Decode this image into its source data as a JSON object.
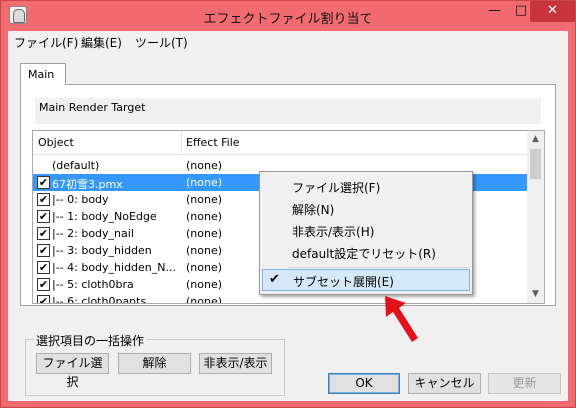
{
  "window": {
    "title": "エフェクトファイル割り当て",
    "minimize": "—",
    "maximize": "□",
    "close": "✕"
  },
  "menu": [
    "ファイル(F)",
    "編集(E)",
    "ツール(T)"
  ],
  "tab": {
    "label": "Main"
  },
  "render_target": {
    "label": "Main Render Target"
  },
  "list": {
    "columns": {
      "object": "Object",
      "effect": "Effect File"
    },
    "rows": [
      {
        "object": "(default)",
        "effect": "(none)",
        "checked": false
      },
      {
        "object": "67初雪3.pmx",
        "effect": "(none)",
        "checked": true,
        "selected": true
      },
      {
        "object": "|-- 0: body",
        "effect": "(none)",
        "checked": true
      },
      {
        "object": "|-- 1: body_NoEdge",
        "effect": "(none)",
        "checked": true
      },
      {
        "object": "|-- 2: body_nail",
        "effect": "(none)",
        "checked": true
      },
      {
        "object": "|-- 3: body_hidden",
        "effect": "(none)",
        "checked": true
      },
      {
        "object": "|-- 4: body_hidden_N...",
        "effect": "(none)",
        "checked": true
      },
      {
        "object": "|-- 5: cloth0bra",
        "effect": "(none)",
        "checked": true
      },
      {
        "object": "|-- 6: cloth0pants",
        "effect": "(none)",
        "checked": true
      }
    ],
    "scroll_up": "▲",
    "scroll_down": "▼"
  },
  "context_menu": {
    "items": [
      "ファイル選択(F)",
      "解除(N)",
      "非表示/表示(H)",
      "default設定でリセット(R)"
    ],
    "checked_item": "サブセット展開(E)",
    "check_mark": "✔"
  },
  "bulk": {
    "title": "選択項目の一括操作",
    "buttons": [
      "ファイル選択",
      "解除",
      "非表示/表示"
    ]
  },
  "dialog_buttons": {
    "ok": "OK",
    "cancel": "キャンセル",
    "update": "更新"
  },
  "colors": {
    "title_bar": "#f26b70",
    "selection": "#3399ff",
    "arrow": "#e4101a"
  }
}
